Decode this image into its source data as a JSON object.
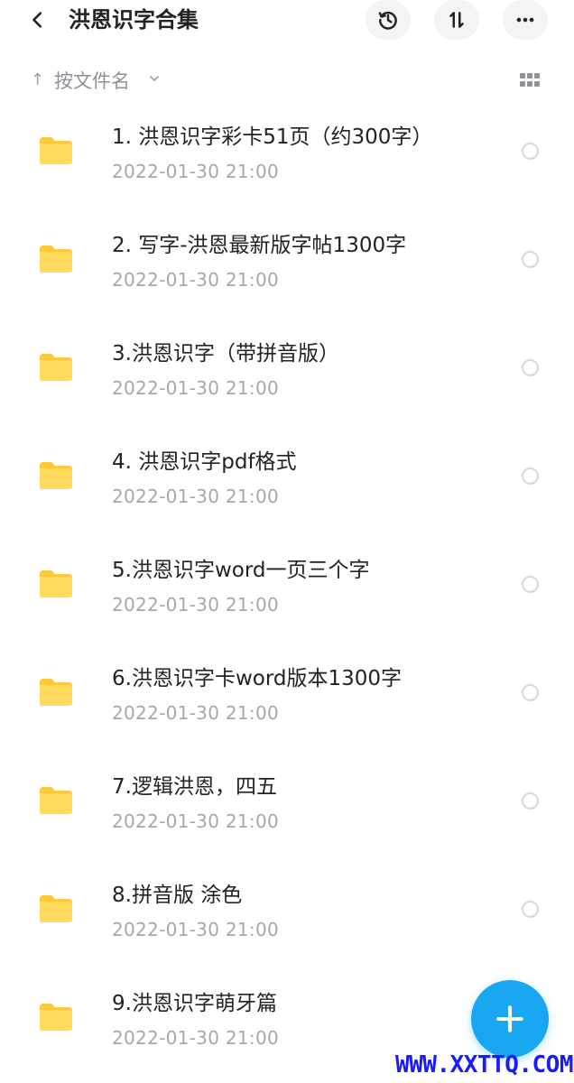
{
  "header": {
    "title": "洪恩识字合集",
    "back_icon": "chevron-left-icon",
    "history_icon": "history-icon",
    "sort_icon": "sort-order-icon",
    "more_icon": "more-horizontal-icon"
  },
  "sortbar": {
    "arrow": "↑",
    "label": "按文件名",
    "caret_icon": "chevron-down-icon",
    "view_icon": "grid-view-icon"
  },
  "files": [
    {
      "name": "1. 洪恩识字彩卡51页（约300字）",
      "date": "2022-01-30  21:00"
    },
    {
      "name": "2. 写字-洪恩最新版字帖1300字",
      "date": "2022-01-30  21:00"
    },
    {
      "name": "3.洪恩识字（带拼音版）",
      "date": "2022-01-30  21:00"
    },
    {
      "name": "4. 洪恩识字pdf格式",
      "date": "2022-01-30  21:00"
    },
    {
      "name": "5.洪恩识字word一页三个字",
      "date": "2022-01-30  21:00"
    },
    {
      "name": "6.洪恩识字卡word版本1300字",
      "date": "2022-01-30  21:00"
    },
    {
      "name": "7.逻辑洪恩，四五",
      "date": "2022-01-30  21:00"
    },
    {
      "name": "8.拼音版 涂色",
      "date": "2022-01-30  21:00"
    },
    {
      "name": "9.洪恩识字萌牙篇",
      "date": "2022-01-30  21:00"
    }
  ],
  "fab": {
    "icon": "plus-icon"
  },
  "watermark": "WWW.XXTTQ.COM",
  "colors": {
    "folder": "#FFD54A",
    "accent": "#1AA7F2",
    "watermark": "#1A1AFF"
  }
}
